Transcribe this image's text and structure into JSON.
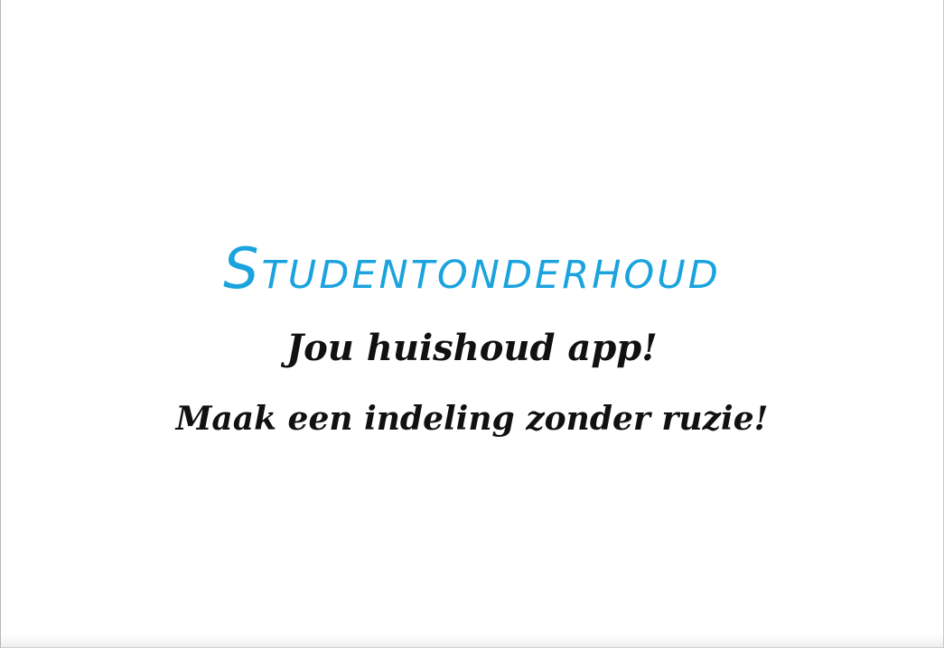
{
  "document": {
    "title": "Studentonderhoud",
    "subtitle": "Jou huishoud app!",
    "tagline": "Maak een indeling zonder ruzie!"
  },
  "colors": {
    "title": "#1aa3dd",
    "text": "#111111",
    "background": "#ffffff"
  }
}
